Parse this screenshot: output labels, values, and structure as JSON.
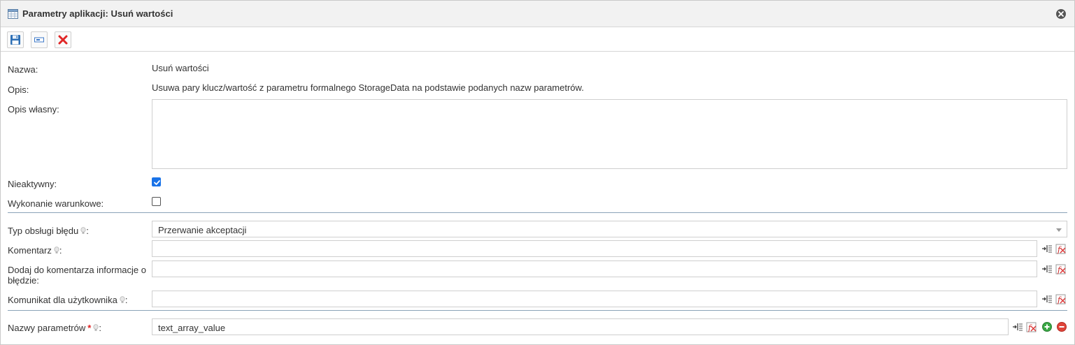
{
  "window": {
    "title": "Parametry aplikacji: Usuń wartości",
    "icon": "table-icon",
    "close_icon": "close-circle-icon"
  },
  "toolbar": {
    "buttons": [
      {
        "name": "save-button",
        "icon": "floppy-disk-icon"
      },
      {
        "name": "expression-button",
        "icon": "input-field-icon"
      },
      {
        "name": "cancel-button",
        "icon": "red-x-icon"
      }
    ]
  },
  "form": {
    "name_label": "Nazwa:",
    "name_value": "Usuń wartości",
    "desc_label": "Opis:",
    "desc_value": "Usuwa pary klucz/wartość z parametru formalnego StorageData na podstawie podanych nazw parametrów.",
    "own_desc_label": "Opis własny:",
    "own_desc_value": "",
    "inactive_label": "Nieaktywny:",
    "inactive_checked": true,
    "conditional_label": "Wykonanie warunkowe:",
    "conditional_checked": false,
    "error_type_label": "Typ obsługi błędu",
    "error_type_value": "Przerwanie akceptacji",
    "comment_label": "Komentarz",
    "comment_value": "",
    "add_info_label_line1": "Dodaj do komentarza informacje o",
    "add_info_label_line2": "błędzie:",
    "add_info_value": "",
    "user_msg_label": "Komunikat dla użytkownika",
    "user_msg_value": "",
    "param_names_label": "Nazwy parametrów",
    "param_names_required": "*",
    "param_names_value": "text_array_value",
    "colon": ":"
  },
  "colors": {
    "accent": "#1a73e8",
    "divider": "#8aa3b8",
    "required": "#e02020",
    "remove": "#e0443a",
    "add": "#3aa845"
  }
}
